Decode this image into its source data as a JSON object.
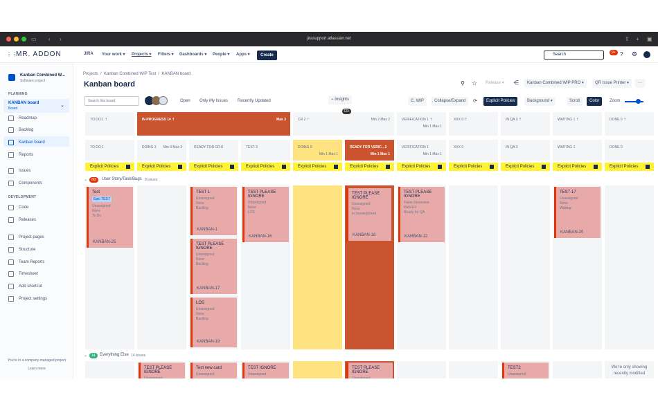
{
  "browser": {
    "url": "jirasupport.atlassian.net"
  },
  "topnav": {
    "brand": "MR. ADDON",
    "jira": "JIRA",
    "items": [
      "Your work ▾",
      "Projects ▾",
      "Filters ▾",
      "Dashboards ▾",
      "People ▾",
      "Apps ▾"
    ],
    "create": "Create",
    "search_placeholder": "Search",
    "notif_count": "9+"
  },
  "sidebar": {
    "project_name": "Kanban Combined W...",
    "project_type": "Software project",
    "planning": "PLANNING",
    "board_name": "KANBAN board",
    "board_sub": "Board",
    "items": [
      "Roadmap",
      "Backlog",
      "Kanban board",
      "Reports",
      "Issues",
      "Components"
    ],
    "development": "DEVELOPMENT",
    "dev_items": [
      "Code",
      "Releases"
    ],
    "other_items": [
      "Project pages",
      "Structure",
      "Team Reports",
      "Timesheet",
      "Add shortcut",
      "Project settings"
    ],
    "footer": "You're in a company-managed project",
    "learn_more": "Learn more"
  },
  "header": {
    "breadcrumb": [
      "Projects",
      "Kanban Combined WIP Test",
      "KANBAN board"
    ],
    "title": "Kanban board",
    "release": "Release ▾",
    "wip_pro": "Kanban Combined WIP PRO ▾",
    "qr": "QR Issue Printer ▾"
  },
  "toolbar": {
    "search_placeholder": "Search this board",
    "open": "Open",
    "only_my": "Only My Issues",
    "recent": "Recently Updated",
    "insights": "Insights",
    "cwip": "C. WIP",
    "collapse": "Collapse/Expand",
    "explicit": "Explicit Policies",
    "background": "Background ▾",
    "scroll": "Scroll",
    "color": "Color",
    "zoom": "Zoom",
    "zoom_level": 0.7
  },
  "top_columns": [
    {
      "name": "TO DO 1",
      "limits": ""
    },
    {
      "name": "IN PROGRESS 14",
      "limits": "Max 3"
    },
    {
      "name": "CR 2",
      "limits": "Min 2 Max 2"
    },
    {
      "name": "VERIFICATION 1",
      "limits": "Min 1 Max 1"
    },
    {
      "name": "XXX 0",
      "limits": ""
    },
    {
      "name": "IN QA 3",
      "limits": ""
    },
    {
      "name": "WAITING 1",
      "limits": ""
    },
    {
      "name": "DONE 0",
      "limits": ""
    }
  ],
  "columns": [
    {
      "name": "TO DO 1",
      "limits": ""
    },
    {
      "name": "DOING 3",
      "limits": "Min 0 Max 3"
    },
    {
      "name": "READY FOR CR 8",
      "limits": ""
    },
    {
      "name": "TEST 3",
      "limits": ""
    },
    {
      "name": "DOING 0",
      "limits": "Min 1 Max 1"
    },
    {
      "name": "READY FOR VERIF... 2",
      "limits": "Min 1 Max 1"
    },
    {
      "name": "VERIFICATION 1",
      "limits": "Min 1 Max 1"
    },
    {
      "name": "XXX 0",
      "limits": ""
    },
    {
      "name": "IN QA 3",
      "limits": ""
    },
    {
      "name": "WAITING 1",
      "limits": ""
    },
    {
      "name": "DONE 0",
      "limits": ""
    }
  ],
  "policy_label": "Explicit Policies",
  "cr_tag": "CR",
  "lane1": {
    "count": "8/3",
    "name": "User Story/Task/Bugs",
    "issues": "8 issues"
  },
  "lane2": {
    "count": "14",
    "name": "Everything Else",
    "issues": "14 issues"
  },
  "cards": [
    {
      "title": "Test",
      "epic": "Epic TEST",
      "assignee": "Unassigned",
      "extra": "None",
      "status": "To Do",
      "key": "KANBAN-25"
    },
    {
      "title": "TEST 1",
      "assignee": "Unassigned",
      "extra": "None",
      "status": "Backlog",
      "key": "KANBAN-1"
    },
    {
      "title": "TEST PLEASE IGNORE",
      "assignee": "Unassigned",
      "extra": "None",
      "status": "Backlog",
      "key": "KANBAN-17"
    },
    {
      "title": "LÖS",
      "assignee": "Unassigned",
      "extra": "None",
      "status": "Backlog",
      "key": "KANBAN-19"
    },
    {
      "title": "TEST PLEASE IGNORE",
      "assignee": "Unassigned",
      "extra": "None",
      "status": "LÖS",
      "key": "KANBAN-16"
    },
    {
      "title": "TEST PLEASE IGNORE",
      "assignee": "Unassigned",
      "extra": "None",
      "status": "In Development",
      "key": "KANBAN-18"
    },
    {
      "title": "TEST PLEASE IGNORE",
      "assignee": "Fabio Genovese",
      "extra": "Web/UX",
      "status": "Ready for QA",
      "key": "KANBAN-12"
    },
    {
      "title": "TEST 17",
      "assignee": "Unassigned",
      "extra": "None",
      "status": "Waiting",
      "key": "KANBAN-20"
    }
  ],
  "lane2_cards": [
    "TEST PLEASE IGNORE",
    "Test new card",
    "TEST IGNORE",
    "TEST PLEASE IGNORE",
    "TEST2"
  ],
  "lane2_sub": "Unassigned",
  "done_note": "We're only showing recently modified"
}
